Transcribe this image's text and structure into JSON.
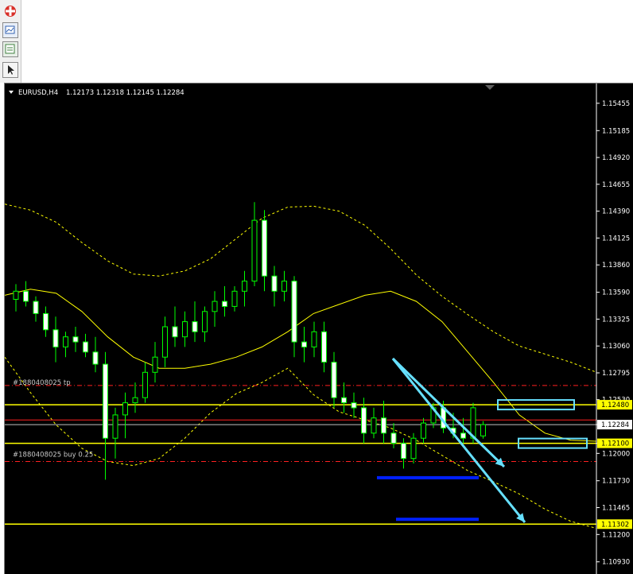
{
  "toolbar": {
    "icons": [
      "app-logo-icon",
      "chart-window-icon",
      "templates-icon",
      "cursor-icon"
    ]
  },
  "chart_data": {
    "type": "candlestick",
    "symbol": "EURUSD,H4",
    "ohlc_header": "1.12173 1.12318 1.12145 1.12284",
    "y_ticks": [
      "1.15455",
      "1.15185",
      "1.14920",
      "1.14655",
      "1.14390",
      "1.14125",
      "1.13860",
      "1.13590",
      "1.13325",
      "1.13060",
      "1.12795",
      "1.12530",
      "1.12284",
      "1.12100",
      "1.12000",
      "1.11730",
      "1.11465",
      "1.11200",
      "1.10930"
    ],
    "ylim": [
      1.1081,
      1.1565
    ],
    "current_price": "1.12284",
    "price_labels": [
      {
        "text": "1.12480",
        "price": 1.1248,
        "bg": "#ffff00"
      },
      {
        "text": "1.12284",
        "price": 1.12284,
        "bg": "#ffffff"
      },
      {
        "text": "1.12100",
        "price": 1.121,
        "bg": "#ffff00"
      },
      {
        "text": "1.11302",
        "price": 1.11302,
        "bg": "#ffff00"
      }
    ],
    "horizontal_lines": [
      {
        "price": 1.1248,
        "color": "#ffff00",
        "style": "solid"
      },
      {
        "price": 1.121,
        "color": "#ffff00",
        "style": "solid"
      },
      {
        "price": 1.11302,
        "color": "#ffff00",
        "style": "solid"
      },
      {
        "price": 1.1267,
        "color": "#ff2020",
        "style": "dashdot"
      },
      {
        "price": 1.1192,
        "color": "#ff2020",
        "style": "dashdot"
      },
      {
        "price": 1.1233,
        "color": "#ff2020",
        "style": "solid"
      },
      {
        "price": 1.12284,
        "color": "#c0c0c0",
        "style": "solid"
      }
    ],
    "order_labels": [
      {
        "text": "#1880408025 tp",
        "price": 1.127
      },
      {
        "text": "#1880408025 buy 0.25",
        "price": 1.1199
      }
    ],
    "bollinger": {
      "color": "#ffff00",
      "middle": [
        1.1356,
        1.1362,
        1.1358,
        1.134,
        1.1315,
        1.1295,
        1.1284,
        1.1284,
        1.1288,
        1.1295,
        1.1305,
        1.132,
        1.1338,
        1.1347,
        1.1356,
        1.136,
        1.135,
        1.133,
        1.13,
        1.127,
        1.1238,
        1.122,
        1.1213,
        1.1212
      ],
      "upper": [
        1.1446,
        1.144,
        1.1428,
        1.1408,
        1.139,
        1.1377,
        1.1375,
        1.138,
        1.1392,
        1.1412,
        1.1432,
        1.1443,
        1.1444,
        1.1439,
        1.1425,
        1.1402,
        1.1376,
        1.1355,
        1.1337,
        1.132,
        1.1306,
        1.1298,
        1.129,
        1.128
      ],
      "lower": [
        1.1295,
        1.126,
        1.1228,
        1.1205,
        1.1192,
        1.1188,
        1.1195,
        1.1215,
        1.124,
        1.1259,
        1.127,
        1.1284,
        1.1258,
        1.1241,
        1.1233,
        1.1225,
        1.1213,
        1.1198,
        1.1183,
        1.1172,
        1.116,
        1.1145,
        1.1133,
        1.1126
      ]
    },
    "arrows": [
      {
        "from": [
          488,
          346
        ],
        "to": [
          628,
          482
        ]
      },
      {
        "from": [
          488,
          346
        ],
        "to": [
          654,
          552
        ]
      }
    ],
    "target_boxes": [
      {
        "price": 1.1248,
        "x": 620,
        "w": 96,
        "color": "#66e0ff"
      },
      {
        "price": 1.121,
        "x": 646,
        "w": 86,
        "color": "#66e0ff"
      }
    ],
    "zones": [
      {
        "price": 1.1176,
        "x": 468,
        "w": 128,
        "color": "#0020ff"
      },
      {
        "price": 1.1135,
        "x": 492,
        "w": 104,
        "color": "#0020ff"
      }
    ],
    "candles": [
      [
        1.1352,
        1.1367,
        1.134,
        1.136
      ],
      [
        1.136,
        1.137,
        1.1345,
        1.135
      ],
      [
        1.135,
        1.1355,
        1.133,
        1.1338
      ],
      [
        1.1338,
        1.1345,
        1.1315,
        1.1322
      ],
      [
        1.1322,
        1.1335,
        1.129,
        1.1305
      ],
      [
        1.1305,
        1.132,
        1.1295,
        1.1315
      ],
      [
        1.1315,
        1.1325,
        1.13,
        1.131
      ],
      [
        1.131,
        1.1318,
        1.1295,
        1.13
      ],
      [
        1.13,
        1.1315,
        1.128,
        1.1288
      ],
      [
        1.1288,
        1.13,
        1.1174,
        1.1215
      ],
      [
        1.1215,
        1.1245,
        1.1195,
        1.1238
      ],
      [
        1.1238,
        1.126,
        1.1215,
        1.125
      ],
      [
        1.125,
        1.127,
        1.124,
        1.1255
      ],
      [
        1.1255,
        1.129,
        1.125,
        1.128
      ],
      [
        1.128,
        1.131,
        1.127,
        1.1295
      ],
      [
        1.1295,
        1.1335,
        1.1285,
        1.1325
      ],
      [
        1.1325,
        1.1345,
        1.1305,
        1.1315
      ],
      [
        1.1315,
        1.134,
        1.1305,
        1.133
      ],
      [
        1.133,
        1.135,
        1.131,
        1.132
      ],
      [
        1.132,
        1.1345,
        1.131,
        1.134
      ],
      [
        1.134,
        1.136,
        1.1325,
        1.135
      ],
      [
        1.135,
        1.1365,
        1.1335,
        1.1345
      ],
      [
        1.1345,
        1.1365,
        1.134,
        1.136
      ],
      [
        1.136,
        1.138,
        1.1345,
        1.137
      ],
      [
        1.137,
        1.1448,
        1.1365,
        1.143
      ],
      [
        1.143,
        1.144,
        1.136,
        1.1375
      ],
      [
        1.1375,
        1.1385,
        1.1345,
        1.136
      ],
      [
        1.136,
        1.138,
        1.135,
        1.137
      ],
      [
        1.137,
        1.1375,
        1.1295,
        1.131
      ],
      [
        1.131,
        1.1325,
        1.129,
        1.1305
      ],
      [
        1.1305,
        1.133,
        1.1295,
        1.132
      ],
      [
        1.132,
        1.133,
        1.128,
        1.129
      ],
      [
        1.129,
        1.13,
        1.1245,
        1.1255
      ],
      [
        1.1255,
        1.127,
        1.124,
        1.125
      ],
      [
        1.125,
        1.126,
        1.1235,
        1.1245
      ],
      [
        1.1245,
        1.1255,
        1.121,
        1.122
      ],
      [
        1.122,
        1.1245,
        1.1215,
        1.1235
      ],
      [
        1.1235,
        1.1252,
        1.121,
        1.122
      ],
      [
        1.122,
        1.123,
        1.1205,
        1.121
      ],
      [
        1.121,
        1.1215,
        1.1185,
        1.1195
      ],
      [
        1.1195,
        1.122,
        1.119,
        1.1215
      ],
      [
        1.1215,
        1.1235,
        1.121,
        1.123
      ],
      [
        1.123,
        1.125,
        1.1225,
        1.1245
      ],
      [
        1.1245,
        1.1252,
        1.122,
        1.1225
      ],
      [
        1.1225,
        1.124,
        1.1215,
        1.122
      ],
      [
        1.122,
        1.1235,
        1.121,
        1.1215
      ],
      [
        1.1215,
        1.125,
        1.121,
        1.1245
      ],
      [
        1.12173,
        1.12318,
        1.12145,
        1.12284
      ]
    ],
    "candle_x_start": 14,
    "candle_x_step": 12.5
  }
}
